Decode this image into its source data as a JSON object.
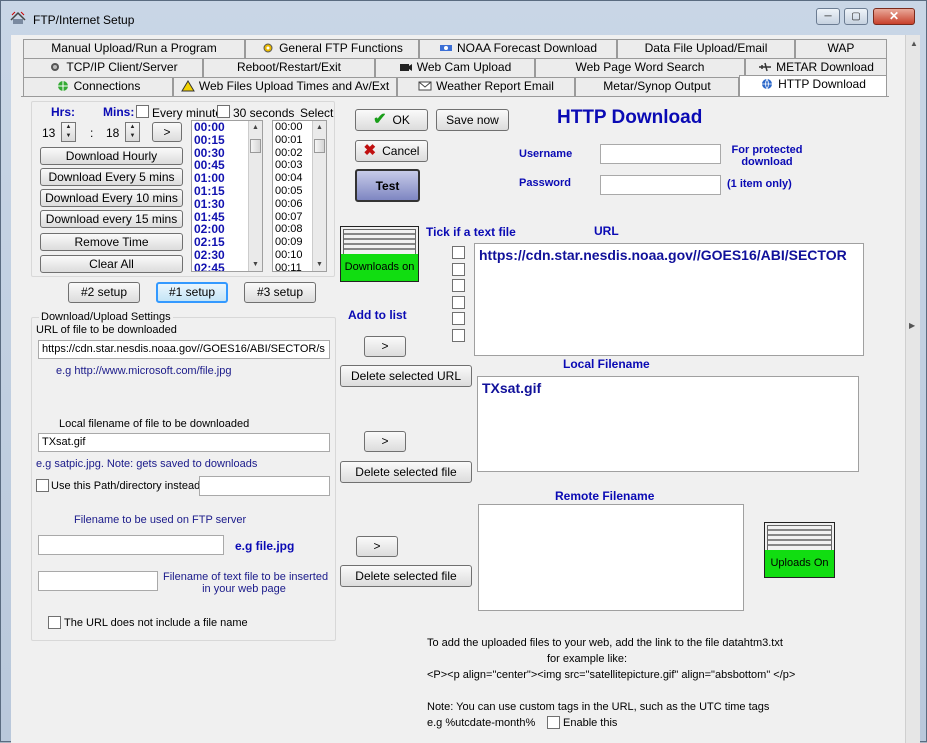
{
  "window": {
    "title": "FTP/Internet Setup",
    "min_label": "─",
    "max_label": "▢",
    "close_label": "✕"
  },
  "tabs": {
    "row1": [
      "Manual Upload/Run a Program",
      "General FTP Functions",
      "NOAA Forecast Download",
      "Data File Upload/Email",
      "WAP"
    ],
    "row2": [
      "TCP/IP Client/Server",
      "Reboot/Restart/Exit",
      "Web Cam Upload",
      "Web Page Word Search",
      "METAR Download"
    ],
    "row3": [
      "Connections",
      "Web Files Upload Times and  Av/Ext",
      "Weather Report Email",
      "Metar/Synop Output",
      "HTTP Download"
    ]
  },
  "schedule": {
    "hrs_label": "Hrs:",
    "mins_label": "Mins:",
    "hrs_value": "13",
    "colon": ":",
    "mins_value": "18",
    "next": ">",
    "every_minute": "Every minute",
    "thirty_seconds": "30 seconds",
    "select_label": "Select",
    "buttons": [
      "Download Hourly",
      "Download Every 5 mins",
      "Download Every 10 mins",
      "Download every 15 mins",
      "Remove Time",
      "Clear All"
    ],
    "times": [
      "00:00",
      "00:15",
      "00:30",
      "00:45",
      "01:00",
      "01:15",
      "01:30",
      "01:45",
      "02:00",
      "02:15",
      "02:30",
      "02:45"
    ],
    "minutes": [
      "00:00",
      "00:01",
      "00:02",
      "00:03",
      "00:04",
      "00:05",
      "00:06",
      "00:07",
      "00:08",
      "00:09",
      "00:10",
      "00:11"
    ]
  },
  "setups": [
    "#2 setup",
    "#1 setup",
    "#3 setup"
  ],
  "settings": {
    "group_label": "Download/Upload Settings",
    "url_label": "URL of file to be downloaded",
    "url_value": "https://cdn.star.nesdis.noaa.gov//GOES16/ABI/SECTOR/s",
    "url_example": "e.g http://www.microsoft.com/file.jpg",
    "local_label": "Local  filename of file to be downloaded",
    "local_value": "TXsat.gif",
    "local_example": "e.g satpic.jpg. Note: gets saved to downloads",
    "use_path_label": "Use this Path/directory instead",
    "ftp_label": "Filename to be used on FTP server",
    "ftp_example": "e.g file.jpg",
    "textfile_label_1": "Filename of text file to be inserted",
    "textfile_label_2": "in your web page",
    "no_filename_label": "The URL does not include a file name"
  },
  "actions": {
    "ok": "OK",
    "save_now": "Save now",
    "cancel": "Cancel",
    "test": "Test"
  },
  "http": {
    "title": "HTTP Download",
    "username_label": "Username",
    "password_label": "Password",
    "protected_1": "For protected",
    "protected_2": "download",
    "protected_3": "(1 item only)",
    "downloads_status": "Downloads on",
    "tick_text_label": "Tick if a text file",
    "url_header": "URL",
    "add_to_list": "Add to list",
    "add_arrow": ">",
    "url_list_value": "https://cdn.star.nesdis.noaa.gov//GOES16/ABI/SECTOR",
    "delete_url": "Delete selected URL",
    "local_header": "Local Filename",
    "local_list_value": "TXsat.gif",
    "delete_file": "Delete selected file",
    "remote_header": "Remote Filename",
    "uploads_status": "Uploads On"
  },
  "notes": {
    "line1": "To add the uploaded files to your web, add the link to the file datahtm3.txt",
    "line2": "for example like:",
    "line3": "<P><p align=\"center\"><img src=\"satellitepicture.gif\" align=\"absbottom\" </p>",
    "line4": "Note: You can use custom tags in the URL, such as the UTC time tags",
    "line5": "e.g %utcdate-month%",
    "enable_label": "Enable this"
  }
}
